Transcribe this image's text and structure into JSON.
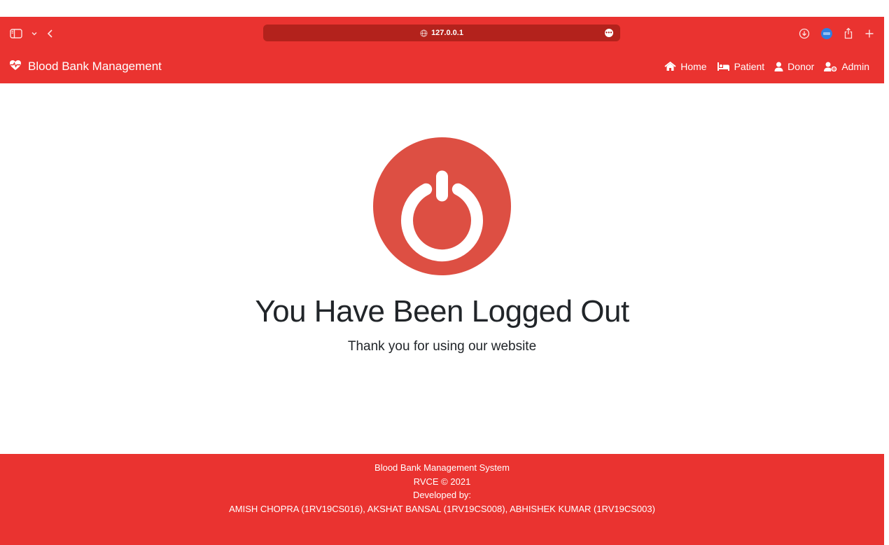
{
  "browser": {
    "url": "127.0.0.1",
    "accent_color": "#ea3330",
    "url_bar_color": "#b3221c",
    "icons": [
      "sidebar-icon",
      "chevron-down-icon",
      "back-icon",
      "globe-icon",
      "more-icon",
      "download-icon",
      "profile-icon",
      "share-icon",
      "new-tab-icon"
    ]
  },
  "navbar": {
    "brand": "Blood Bank Management",
    "brand_icon": "heart-pulse-icon",
    "links": [
      {
        "label": "Home",
        "icon": "home-icon"
      },
      {
        "label": "Patient",
        "icon": "bed-icon"
      },
      {
        "label": "Donor",
        "icon": "user-icon"
      },
      {
        "label": "Admin",
        "icon": "user-gear-icon"
      }
    ]
  },
  "main": {
    "icon": "power-icon",
    "icon_color": "#dd4f43",
    "title": "You Have Been Logged Out",
    "subtitle": "Thank you for using our website"
  },
  "footer": {
    "lines": [
      "Blood Bank Management System",
      "RVCE © 2021",
      "Developed by:",
      "AMISH CHOPRA (1RV19CS016), AKSHAT BANSAL (1RV19CS008), ABHISHEK KUMAR (1RV19CS003)"
    ]
  }
}
